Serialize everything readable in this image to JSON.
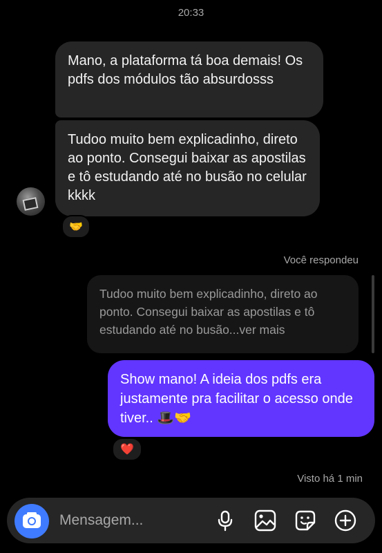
{
  "header": {
    "time": "20:33"
  },
  "messages": {
    "incoming": [
      {
        "text": "Mano, a plataforma tá boa demais! Os pdfs dos módulos tão absurdosss"
      },
      {
        "text": "Tudoo muito bem explicadinho, direto ao ponto. Consegui baixar as apostilas e tô estudando até no busão no celular kkkk",
        "reaction": "🤝"
      }
    ],
    "reply": {
      "label": "Você respondeu",
      "quote": "Tudoo muito bem explicadinho, direto ao ponto. Consegui baixar as apostilas e tô estudando até no busão...ver mais"
    },
    "outgoing": {
      "text": "Show mano! A ideia dos pdfs era justamente pra facilitar o acesso onde tiver.. 🎩🤝",
      "reaction": "❤️",
      "status": "Visto há 1 min"
    }
  },
  "composer": {
    "placeholder": "Mensagem...",
    "icons": [
      "camera-icon",
      "microphone-icon",
      "gallery-icon",
      "sticker-icon",
      "plus-icon"
    ]
  },
  "colors": {
    "background": "#000000",
    "incoming_bubble": "#262626",
    "outgoing_bubble": "#6236ff",
    "camera_button": "#3f7bff",
    "muted_text": "#a8a8a8"
  }
}
